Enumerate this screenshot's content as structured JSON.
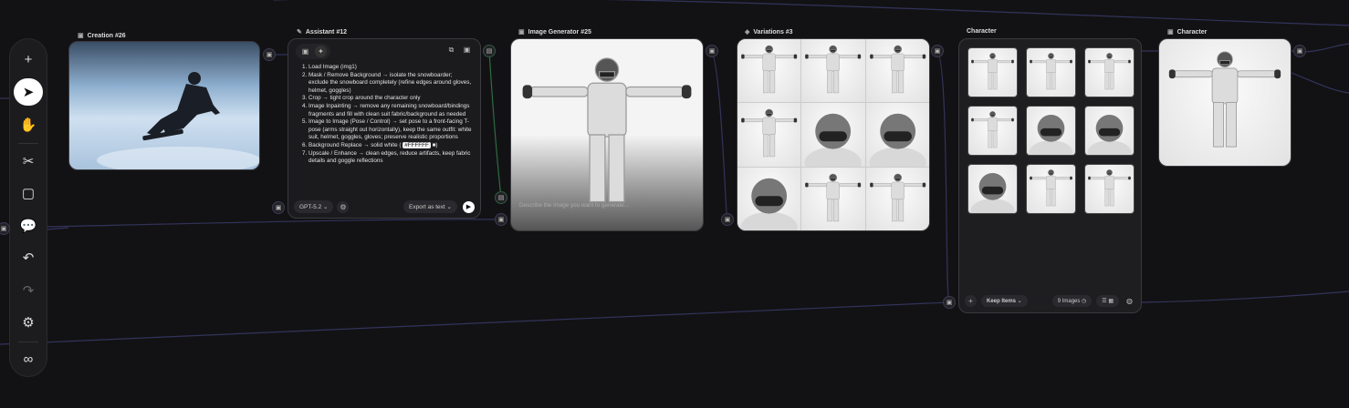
{
  "toolbar": {
    "items": [
      {
        "name": "add",
        "icon": "+"
      },
      {
        "name": "select",
        "icon": "➤"
      },
      {
        "name": "pan",
        "icon": "✋"
      },
      {
        "name": "cut",
        "icon": "✂"
      },
      {
        "name": "note",
        "icon": "▢"
      },
      {
        "name": "comment",
        "icon": "💬"
      },
      {
        "name": "undo",
        "icon": "↶"
      },
      {
        "name": "redo",
        "icon": "↷"
      },
      {
        "name": "settings",
        "icon": "⚙"
      },
      {
        "name": "infinite",
        "icon": "∞"
      }
    ]
  },
  "nodes": {
    "creation": {
      "title": "Creation #26"
    },
    "assistant": {
      "title": "Assistant #12",
      "steps": [
        "Load Image (img1)",
        "Mask / Remove Background → isolate the snowboarder; exclude the snowboard completely (refine edges around gloves, helmet, goggles)",
        "Crop → tight crop around the character only",
        "Image Inpainting → remove any remaining snowboard/bindings fragments and fill with clean suit fabric/background as needed",
        "Image to Image (Pose / Control) → set pose to a front-facing T-pose (arms straight out horizontally), keep the same outfit: white suit, helmet, goggles, gloves; preserve realistic proportions",
        "Background Replace → solid white (",
        "Upscale / Enhance → clean edges, reduce artifacts, keep fabric details and goggle reflections"
      ],
      "color_code": "#FFFFFF",
      "model": "GPT-5.2",
      "export_label": "Export as text"
    },
    "generator": {
      "title": "Image Generator #25",
      "placeholder": "Describe the image you want to generate..."
    },
    "variations": {
      "title": "Variations #3"
    },
    "character_list": {
      "title": "Character",
      "keep_label": "Keep Items",
      "count_label": "9 Images"
    },
    "character": {
      "title": "Character"
    }
  },
  "colors": {
    "background": "#121214",
    "wire": "#3b3b6a",
    "wire_green": "#2f6b45"
  }
}
